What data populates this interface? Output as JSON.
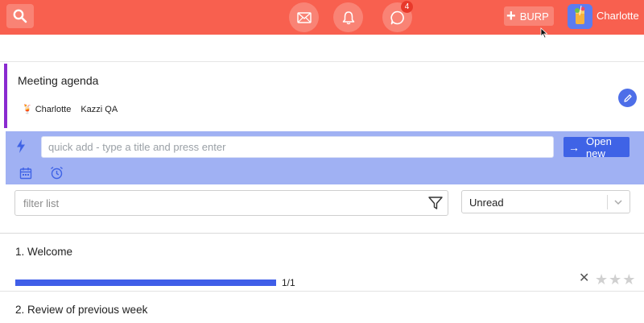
{
  "colors": {
    "topbar": "#f8604f",
    "accent": "#3f63e6",
    "meeting_stripe": "#8a2bd0",
    "quickadd_panel": "#a0b1f3"
  },
  "topbar": {
    "search_icon": "search-icon",
    "mail_icon": "mail-icon",
    "bell_icon": "bell-icon",
    "chat_icon": "chat-icon",
    "chat_badge": "4",
    "burp_label": "BURP",
    "user_name": "Charlotte"
  },
  "meeting": {
    "title": "Meeting agenda",
    "participants": [
      {
        "name": "Charlotte",
        "icon": "cocktail-icon"
      },
      {
        "name": "Kazzi QA"
      }
    ],
    "edit_icon": "pencil-icon"
  },
  "quickadd": {
    "placeholder": "quick add - type a title and press enter",
    "open_new_label": "Open new",
    "icons": [
      "bolt-icon",
      "calendar-icon",
      "alarm-clock-icon"
    ]
  },
  "filter": {
    "placeholder": "filter list",
    "select_value": "Unread"
  },
  "items": [
    {
      "title": "1. Welcome",
      "progress_label": "1/1",
      "progress_fraction": 1.0,
      "rating": 0,
      "rating_max": 3
    },
    {
      "title": "2. Review of previous week"
    }
  ]
}
